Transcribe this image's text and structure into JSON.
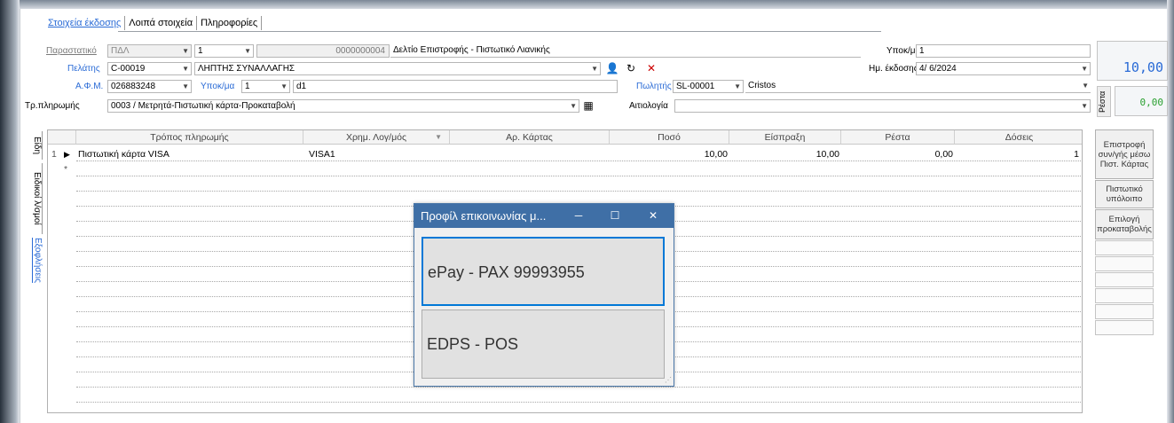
{
  "tabs": [
    "Στοιχεία έκδοσης",
    "Λοιπά στοιχεία",
    "Πληροφορίες"
  ],
  "header": {
    "parastatiko_label": "Παραστατικό",
    "parastatiko_code": "ΠΔΛ",
    "series": "1",
    "number": "0000000004",
    "doc_desc": "Δελτίο Επιστροφής - Πιστωτικό Λιανικής",
    "branch_label": "Υποκ/μα",
    "branch_value": "1",
    "customer_label": "Πελάτης",
    "customer_code": "C-00019",
    "customer_name": "ΛΗΠΤΗΣ ΣΥΝΑΛΛΑΓΗΣ",
    "issue_label": "Ημ. έκδοσης",
    "issue_date": "4/ 6/2024",
    "afm_label": "Α.Φ.Μ.",
    "afm_value": "026883248",
    "sub_label": "Υποκ/μα",
    "sub_value": "1",
    "sub_name": "d1",
    "seller_label": "Πωλητής",
    "seller_code": "SL-00001",
    "seller_name": "Cristos",
    "payment_label": "Τρ.πληρωμής",
    "payment_value": "0003 / Μετρητά-Πιστωτική κάρτα-Προκαταβολή",
    "reason_label": "Αιτιολογία",
    "reason_value": ""
  },
  "totals": {
    "total": "10,00",
    "resta_label": "Ρέστα",
    "resta": "0,00"
  },
  "side_buttons": [
    "Επιστροφή συν/γής μέσω Πιστ. Κάρτας",
    "Πιστωτικό υπόλοιπο",
    "Επιλογή προκαταβολής"
  ],
  "vertical_tabs": [
    "Είδη",
    "Ειδικοί λ/σμοί",
    "Εξοφλήσεις"
  ],
  "grid": {
    "columns": [
      "Τρόπος πληρωμής",
      "Χρημ. Λογ/μός",
      "Αρ. Κάρτας",
      "Ποσό",
      "Είσπραξη",
      "Ρέστα",
      "Δόσεις"
    ],
    "rows": [
      {
        "num": "1",
        "method": "Πιστωτική κάρτα VISA",
        "account": "VISA1",
        "card": "",
        "amount": "10,00",
        "received": "10,00",
        "change": "0,00",
        "installments": "1"
      }
    ],
    "new_row_marker": "*"
  },
  "dialog": {
    "title": "Προφίλ επικοινωνίας μ...",
    "options": [
      "ePay - PAX 99993955",
      "EDPS - POS"
    ]
  },
  "colors": {
    "accent": "#3f6fa6",
    "link": "#2a6bd6"
  }
}
